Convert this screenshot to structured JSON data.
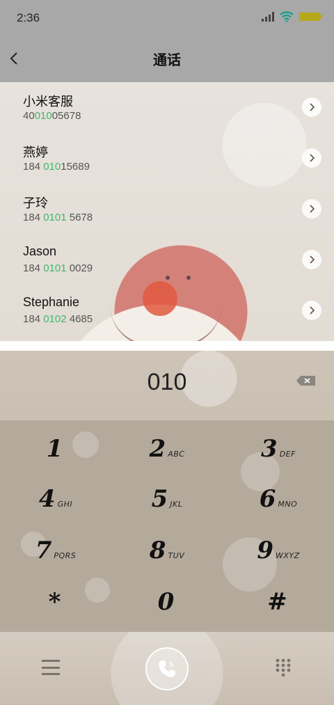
{
  "status_bar": {
    "time": "2:36"
  },
  "header": {
    "title": "通话"
  },
  "contacts": [
    {
      "name": "小米客服",
      "number_pre": "40",
      "number_match": "010",
      "number_post": "05678"
    },
    {
      "name": "燕婷",
      "number_pre": "184 ",
      "number_match": "010",
      "number_post": "15689"
    },
    {
      "name": "子玲",
      "number_pre": "184 ",
      "number_match": "0101",
      "number_post": " 5678"
    },
    {
      "name": "Jason",
      "number_pre": "184 ",
      "number_match": "0101",
      "number_post": " 0029"
    },
    {
      "name": "Stephanie",
      "number_pre": "184 ",
      "number_match": "0102",
      "number_post": " 4685"
    }
  ],
  "dialer": {
    "entered_number": "010",
    "keys": [
      {
        "digit": "1",
        "letters": ""
      },
      {
        "digit": "2",
        "letters": "ABC"
      },
      {
        "digit": "3",
        "letters": "DEF"
      },
      {
        "digit": "4",
        "letters": "GHI"
      },
      {
        "digit": "5",
        "letters": "JKL"
      },
      {
        "digit": "6",
        "letters": "MNO"
      },
      {
        "digit": "7",
        "letters": "PQRS"
      },
      {
        "digit": "8",
        "letters": "TUV"
      },
      {
        "digit": "9",
        "letters": "WXYZ"
      },
      {
        "digit": "*",
        "letters": ""
      },
      {
        "digit": "0",
        "letters": ""
      },
      {
        "digit": "#",
        "letters": ""
      }
    ]
  },
  "colors": {
    "match_highlight": "#3fb86a",
    "battery": "#b5a91b",
    "wifi": "#1aa38a"
  },
  "icons": {
    "back": "chevron-left-icon",
    "details": "chevron-right-icon",
    "delete": "backspace-icon",
    "menu": "menu-icon",
    "call": "phone-icon",
    "dialpad": "dialpad-icon"
  }
}
